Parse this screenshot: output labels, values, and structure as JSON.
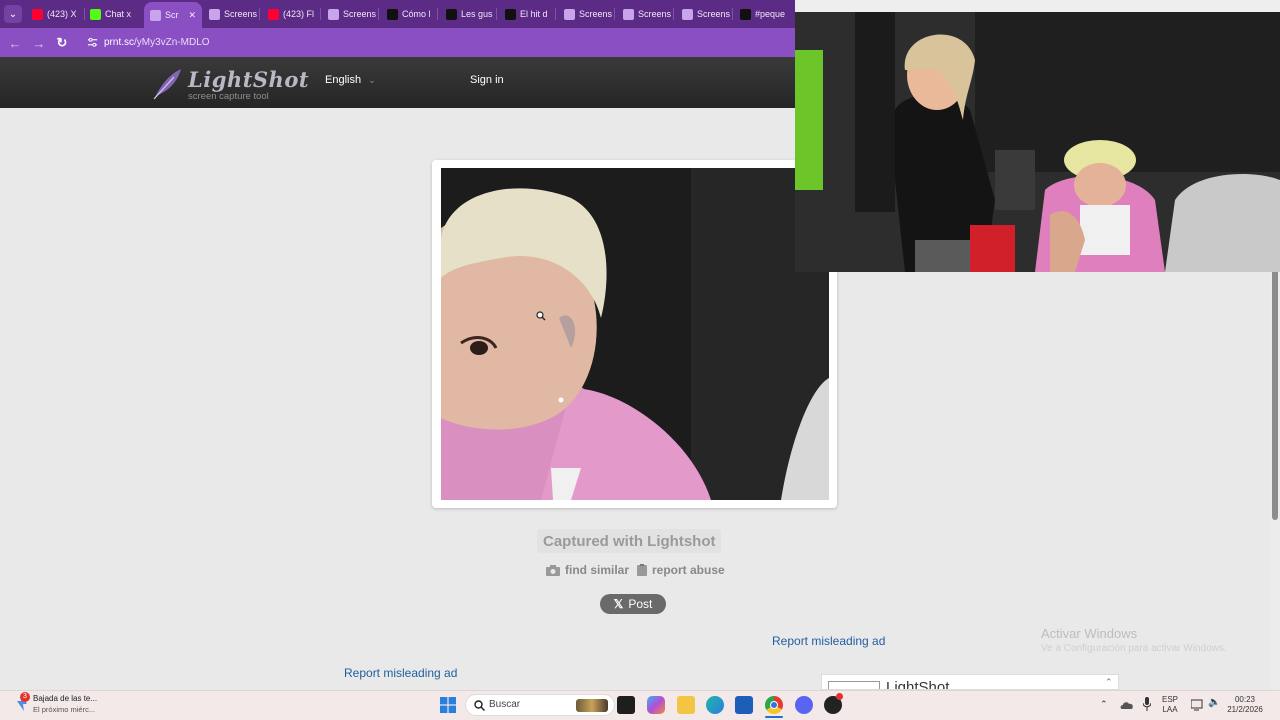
{
  "browser": {
    "tabs": [
      {
        "label": "(423) X",
        "icon": "youtube-icon",
        "color": "#ff0033"
      },
      {
        "label": "Chat x",
        "icon": "kick-icon",
        "color": "#53fc18"
      },
      {
        "label": "Scr",
        "icon": "lightshot-icon",
        "color": "#c7a4ec",
        "active": true
      },
      {
        "label": "Screens",
        "icon": "lightshot-icon",
        "color": "#c7a4ec"
      },
      {
        "label": "(423) Fl",
        "icon": "youtube-icon",
        "color": "#ff0033"
      },
      {
        "label": "Screens",
        "icon": "lightshot-icon",
        "color": "#c7a4ec"
      },
      {
        "label": "Cómo l",
        "icon": "tiktok-icon",
        "color": "#111111"
      },
      {
        "label": "Les gus",
        "icon": "tiktok-icon",
        "color": "#111111"
      },
      {
        "label": "El hit d",
        "icon": "tiktok-icon",
        "color": "#111111"
      },
      {
        "label": "Screens",
        "icon": "lightshot-icon",
        "color": "#c7a4ec"
      },
      {
        "label": "Screens",
        "icon": "lightshot-icon",
        "color": "#c7a4ec"
      },
      {
        "label": "Screens",
        "icon": "lightshot-icon",
        "color": "#c7a4ec"
      },
      {
        "label": "#peque",
        "icon": "tiktok-icon",
        "color": "#111111"
      }
    ],
    "close_glyph": "✕",
    "url_host": "prnt.sc",
    "url_path": "/yMy3vZn-MDLO",
    "colors": {
      "tabstrip": "#5b2b86",
      "toolbar": "#8b4fc4"
    }
  },
  "lightshot": {
    "logo_title": "LightShot",
    "logo_subtitle": "screen capture tool",
    "language": "English",
    "language_caret": "⌄",
    "signin": "Sign in",
    "captured_label": "Captured with Lightshot",
    "find_similar": "find similar",
    "report_abuse": "report abuse",
    "post_label": "Post",
    "report_ad_1": "Report misleading ad",
    "report_ad_2": "Report misleading ad",
    "ad_partial_text": "LightShot"
  },
  "windows": {
    "activate_title": "Activar Windows",
    "activate_sub": "Ve a Configuración para activar Windows."
  },
  "taskbar": {
    "notification_title": "Bajada de las te...",
    "notification_sub": "El próximo miérc...",
    "notification_badge": "3",
    "search_placeholder": "Buscar",
    "lang_line1": "ESP",
    "lang_line2": "LAA",
    "time": "00:23",
    "date": "21/2/2026"
  }
}
